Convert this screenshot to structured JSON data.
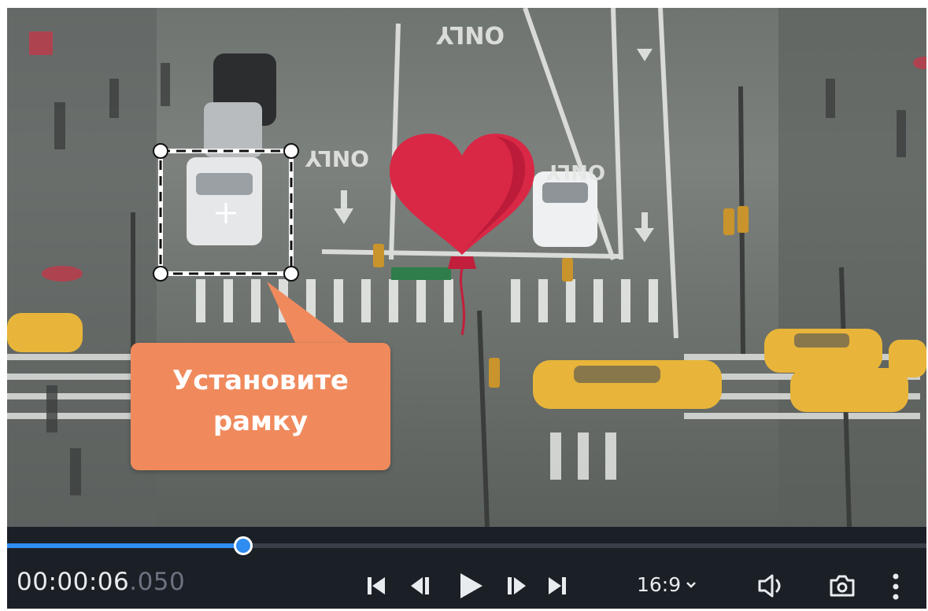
{
  "overlay": {
    "callout_line1": "Установите",
    "callout_line2": "рамку",
    "callout_color": "#f08a5d",
    "heart_color": "#d92846",
    "road_text_1": "ONLY",
    "road_text_2": "ONLY",
    "road_text_3": "ONLY"
  },
  "controls": {
    "timecode_main": "00:00:06",
    "timecode_ms": ".050",
    "aspect_ratio": "16:9",
    "progress_fraction": 0.257,
    "accent_color": "#2f8cf0",
    "icons": {
      "skip_start": "skip-to-start-icon",
      "prev_frame": "previous-frame-icon",
      "play": "play-icon",
      "next_frame": "next-frame-icon",
      "skip_end": "skip-to-end-icon",
      "ratio_chevron": "chevron-down-icon",
      "volume": "volume-icon",
      "snapshot": "camera-icon",
      "more": "more-vertical-icon"
    }
  }
}
